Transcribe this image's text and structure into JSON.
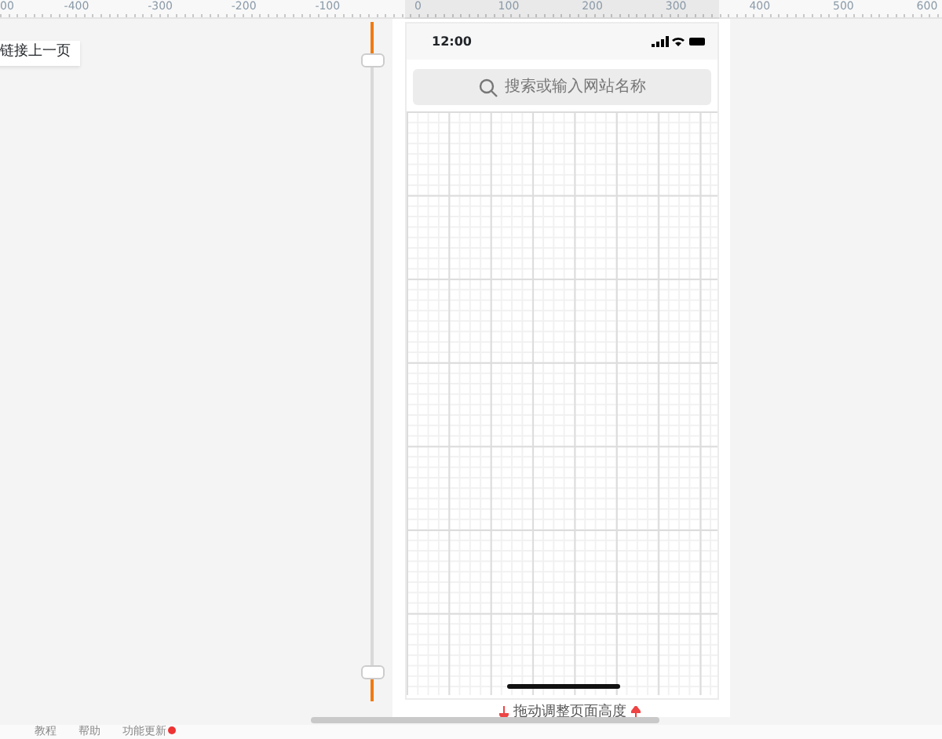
{
  "ruler": {
    "labels": [
      "00",
      "-400",
      "-300",
      "-200",
      "-100",
      "0",
      "100",
      "200",
      "300",
      "400",
      "500",
      "600"
    ]
  },
  "link_tag": {
    "label": "链接上一页"
  },
  "phone": {
    "status_bar": {
      "time": "12:00"
    },
    "search": {
      "placeholder": "搜索或输入网站名称"
    }
  },
  "resize_hint": "拖动调整页面高度",
  "bottom_bar": [
    {
      "label": "教程",
      "badge": false
    },
    {
      "label": "帮助",
      "badge": false
    },
    {
      "label": "功能更新",
      "badge": true
    }
  ]
}
